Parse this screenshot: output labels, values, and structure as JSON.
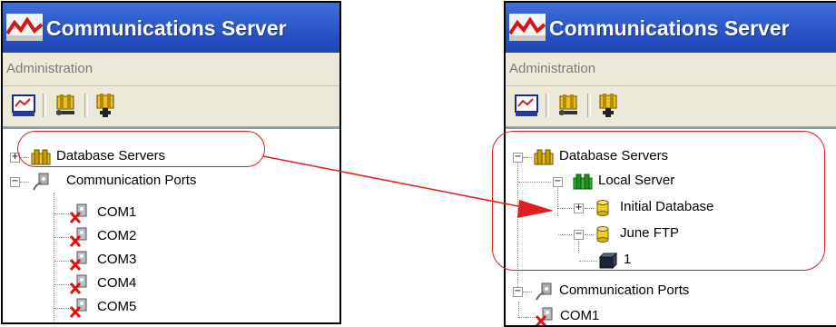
{
  "app": {
    "title": "Communications Server"
  },
  "menu": {
    "administration": "Administration"
  },
  "toolbar": {
    "icons": [
      "monitor-icon",
      "db-tool-icon",
      "add-server-icon"
    ]
  },
  "left_tree": {
    "database_servers": "Database Servers",
    "communication_ports": "Communication Ports",
    "ports": [
      "COM1",
      "COM2",
      "COM3",
      "COM4",
      "COM5"
    ]
  },
  "right_tree": {
    "database_servers": "Database Servers",
    "local_server": "Local Server",
    "initial_database": "Initial Database",
    "june_ftp": "June FTP",
    "item_1": "1",
    "communication_ports": "Communication Ports",
    "port": "COM1"
  },
  "colors": {
    "callout": "#e02020",
    "title_bar": "#2a55c7",
    "toolbar": "#ece9d8"
  }
}
